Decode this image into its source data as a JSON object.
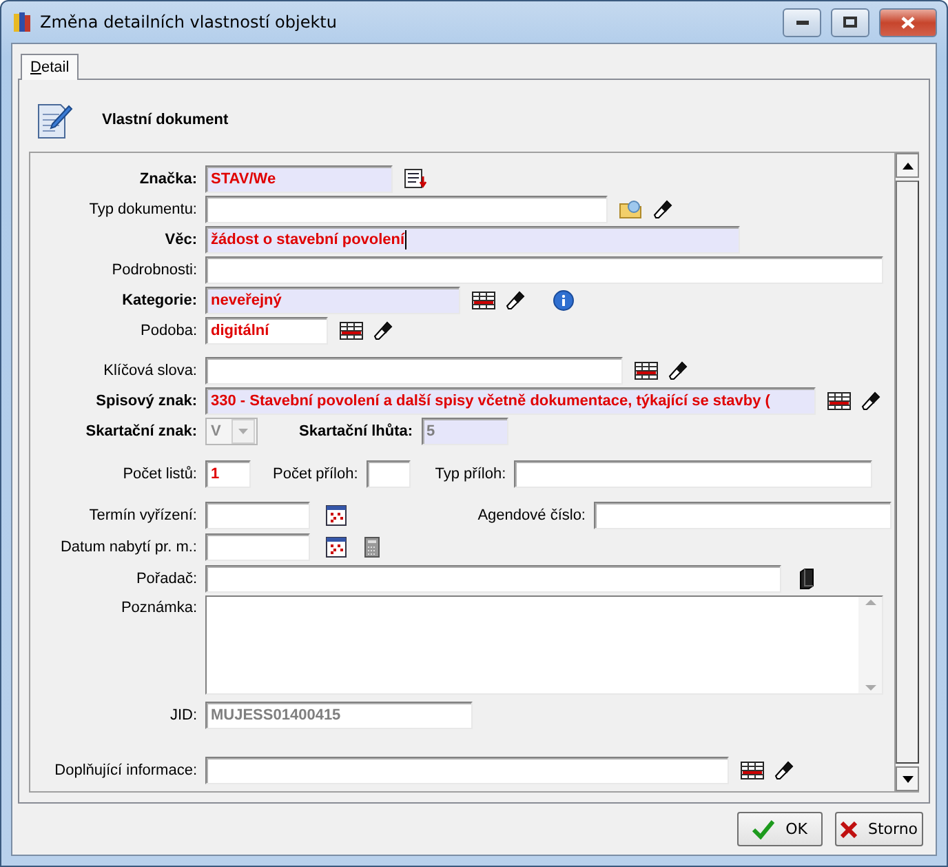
{
  "window": {
    "title": "Změna detailních vlastností objektu"
  },
  "tabs": [
    {
      "label": "Detail",
      "selected": true
    }
  ],
  "header": {
    "title": "Vlastní dokument"
  },
  "rows": [
    {
      "items": [
        {
          "kind": "field",
          "label": "Značka:",
          "bold_label": true,
          "highlighted": true,
          "value": "STAV/We"
        },
        {
          "kind": "list"
        }
      ]
    },
    {
      "items": [
        {
          "kind": "field",
          "label": "Typ dokumentu:",
          "bold_label": false,
          "highlighted": false
        },
        {
          "kind": "folder"
        },
        {
          "kind": "eraser"
        }
      ]
    },
    {
      "items": [
        {
          "kind": "field",
          "label": "Věc:",
          "bold_label": true,
          "highlighted": true,
          "value": "žádost o stavební povolení",
          "focused": true
        }
      ]
    },
    {
      "items": [
        {
          "kind": "field",
          "label": "Podrobnosti:",
          "bold_label": false,
          "highlighted": false
        }
      ]
    },
    {
      "items": [
        {
          "kind": "field",
          "label": "Kategorie:",
          "bold_label": true,
          "highlighted": true,
          "value": "neveřejný"
        },
        {
          "kind": "table"
        },
        {
          "kind": "eraser"
        },
        {
          "kind": "info"
        }
      ]
    },
    {
      "items": [
        {
          "kind": "field",
          "label": "Podoba:",
          "bold_label": false,
          "highlighted": false,
          "value": "digitální"
        },
        {
          "kind": "table"
        },
        {
          "kind": "eraser"
        }
      ]
    },
    {
      "items": [
        {
          "kind": "field",
          "label": "Klíčová slova:",
          "bold_label": false,
          "highlighted": false
        },
        {
          "kind": "table"
        },
        {
          "kind": "eraser"
        }
      ]
    },
    {
      "items": [
        {
          "kind": "field",
          "label": "Spisový znak:",
          "bold_label": true,
          "highlighted": true,
          "value": "330 - Stavební povolení a další spisy včetně dokumentace, týkající se stavby ("
        },
        {
          "kind": "table"
        },
        {
          "kind": "eraser"
        }
      ]
    },
    {
      "items": [
        {
          "kind": "combo",
          "label": "Skartační znak:",
          "bold_label": true,
          "disabled": true,
          "value": "V"
        },
        {
          "kind": "field",
          "label": "Skartační lhůta:",
          "bold_label": true,
          "highlighted": true,
          "disabled": true,
          "value": "5"
        }
      ]
    },
    {
      "items": [
        {
          "kind": "field",
          "label": "Počet listů:",
          "bold_label": false,
          "highlighted": false,
          "value": "1"
        },
        {
          "kind": "field",
          "label": "Počet příloh:",
          "bold_label": false,
          "highlighted": false
        },
        {
          "kind": "field",
          "label": "Typ příloh:",
          "bold_label": false,
          "highlighted": false
        }
      ]
    },
    {
      "items": [
        {
          "kind": "field",
          "label": "Termín vyřízení:",
          "bold_label": false,
          "highlighted": false
        },
        {
          "kind": "calendar"
        },
        {
          "kind": "field",
          "label": "Agendové číslo:",
          "bold_label": false,
          "highlighted": false
        }
      ]
    },
    {
      "items": [
        {
          "kind": "field",
          "label": "Datum nabytí pr. m.:",
          "bold_label": false,
          "highlighted": false
        },
        {
          "kind": "calendar"
        },
        {
          "kind": "calculator"
        }
      ]
    },
    {
      "items": [
        {
          "kind": "field",
          "label": "Pořadač:",
          "bold_label": false,
          "highlighted": false
        },
        {
          "kind": "binder"
        }
      ]
    },
    {
      "items": [
        {
          "kind": "textarea",
          "label": "Poznámka:",
          "bold_label": false
        }
      ]
    },
    {
      "items": [
        {
          "kind": "field",
          "label": "JID:",
          "bold_label": false,
          "highlighted": false,
          "disabled": true,
          "value": "MUJESS01400415"
        }
      ]
    },
    {
      "items": [
        {
          "kind": "field",
          "label": "Doplňující informace:",
          "bold_label": false,
          "highlighted": false
        },
        {
          "kind": "table"
        },
        {
          "kind": "eraser"
        }
      ]
    }
  ],
  "buttons": [
    {
      "kind": "ok",
      "label": "OK"
    },
    {
      "kind": "cancel",
      "label": "Storno"
    }
  ]
}
